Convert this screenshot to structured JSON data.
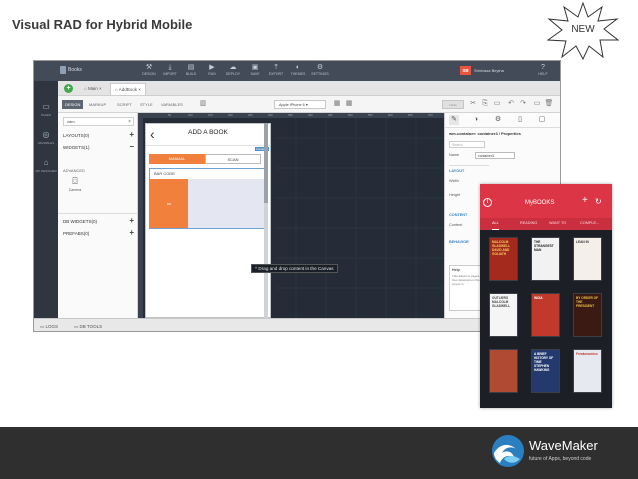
{
  "slide": {
    "title": "Visual RAD for Hybrid Mobile",
    "badge": "NEW"
  },
  "ide": {
    "app_name": "Books",
    "top_actions": [
      "DESIGN",
      "IMPORT",
      "BUILD",
      "RUN",
      "DEPLOY",
      "SAVE",
      "EXPORT",
      "THEMES",
      "SETTINGS"
    ],
    "user_initials": "SB",
    "user_name": "Srinivasa Beyina",
    "help_label": "HELP",
    "rail": [
      {
        "label": "PAGES",
        "icon": "pages-icon"
      },
      {
        "label": "VARIABLES",
        "icon": "variables-icon"
      },
      {
        "label": "API DESIGNER",
        "icon": "api-designer-icon"
      }
    ],
    "page_tabs": [
      "Main",
      "AddBook"
    ],
    "view_tabs": [
      "DESIGN",
      "MARKUP",
      "SCRIPT",
      "STYLE",
      "VARIABLES"
    ],
    "device": "Apple iPhone 6",
    "undo_label": "Undo",
    "widgets": {
      "search_value": "cam",
      "rows": [
        {
          "label": "LAYOUTS(0)",
          "sign": "+"
        },
        {
          "label": "WIDGETS(1)",
          "sign": "−"
        }
      ],
      "advanced_label": "ADVANCED",
      "canvas_label": "Camera",
      "bottom_rows": [
        {
          "label": "DB WIDGETS(0)",
          "sign": "+"
        },
        {
          "label": "PREFABS(0)",
          "sign": "+"
        }
      ]
    },
    "ruler_marks": [
      "50",
      "100",
      "150",
      "200",
      "250",
      "300",
      "350",
      "400",
      "450",
      "500",
      "550",
      "600",
      "650",
      "700"
    ],
    "phone": {
      "back": "‹",
      "title": "ADD A BOOK",
      "container_tag": "Container",
      "seg_on": "MANUAL",
      "seg_off": "SCAN",
      "bar_code": "BAR CODE",
      "block_label": "ss"
    },
    "drag_tip": "^ Drag and drop content in the Canvas",
    "props": {
      "title": "wm-container: container3 / Properties",
      "search_placeholder": "Search",
      "name_label": "Name",
      "name_value": "container3",
      "layout_section": "LAYOUT",
      "width_label": "Width",
      "height_label": "Height",
      "content_section": "CONTENT",
      "content_label": "Content",
      "behavior_section": "BEHAVIOR",
      "help_title": "Help",
      "help_text": "This allows to pages. Use developmen the proper w"
    },
    "status": [
      "LOGS",
      "DB TOOLS"
    ]
  },
  "mobile_app": {
    "title": "MyBOOKS",
    "tabs": [
      "ALL",
      "READING",
      "WANT TO",
      "COMPLE..."
    ],
    "books": [
      {
        "text": "MALCOLM GLADWELL DAVID AND GOLIATH",
        "bg": "#a52a1e",
        "fg": "#f5d35b"
      },
      {
        "text": "THE STRANGEST MAN",
        "bg": "#f2f2f2",
        "fg": "#222222"
      },
      {
        "text": "LEAN IN",
        "bg": "#f4efe8",
        "fg": "#333333"
      },
      {
        "text": "OUTLIERS MALCOLM GLADWELL",
        "bg": "#f5f5f5",
        "fg": "#444444"
      },
      {
        "text": "INDIA",
        "bg": "#c0392b",
        "fg": "#ffffff"
      },
      {
        "text": "BY ORDER OF THE PRESIDENT",
        "bg": "#3a1a12",
        "fg": "#f0c24a"
      },
      {
        "text": "",
        "bg": "#b04a32",
        "fg": "#ffffff"
      },
      {
        "text": "A BRIEF HISTORY OF TIME STEPHEN HAWKING",
        "bg": "#243a6e",
        "fg": "#ffffff"
      },
      {
        "text": "Freakonomics",
        "bg": "#e6e9ef",
        "fg": "#c0392b"
      }
    ],
    "colors": {
      "header": "#dc3545",
      "tabs": "#c92f3f"
    }
  },
  "footer": {
    "brand": "WaveMaker",
    "tagline": "future of Apps, beyond code"
  }
}
